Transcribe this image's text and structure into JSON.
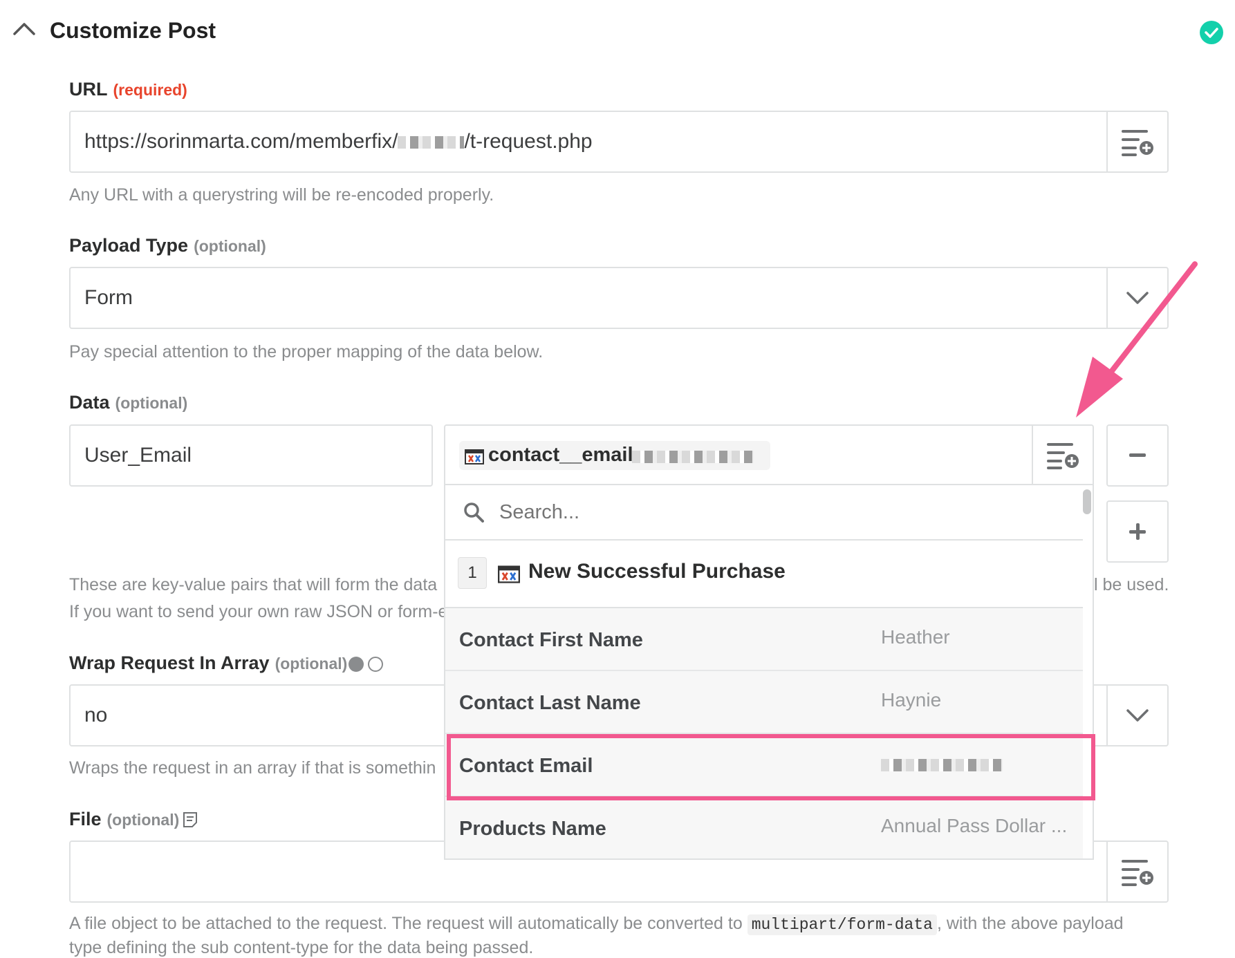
{
  "section": {
    "title": "Customize Post"
  },
  "url_field": {
    "label": "URL",
    "required_tag": "(required)",
    "value_prefix": "https://sorinmarta.com/memberfix/",
    "value_suffix": "/t-request.php",
    "help": "Any URL with a querystring will be re-encoded properly."
  },
  "payload_field": {
    "label": "Payload Type",
    "optional_tag": "(optional)",
    "value": "Form",
    "help": "Pay special attention to the proper mapping of the data below."
  },
  "data_field": {
    "label": "Data",
    "optional_tag": "(optional)",
    "key_value": "User_Email",
    "token_label": "contact__email:",
    "help_line1": "These are key-value pairs that will form the data",
    "help_line1_end": "l be used.",
    "help_line2": "If you want to send your own raw JSON or form-e"
  },
  "dropdown": {
    "search_placeholder": "Search...",
    "step_number": "1",
    "step_title": "New Successful Purchase",
    "items": [
      {
        "key": "Contact First Name",
        "value": "Heather"
      },
      {
        "key": "Contact Last Name",
        "value": "Haynie"
      },
      {
        "key": "Contact Email",
        "value": ""
      },
      {
        "key": "Products Name",
        "value": "Annual Pass Dollar ..."
      }
    ]
  },
  "wrap_field": {
    "label": "Wrap Request In Array",
    "optional_tag": "(optional)",
    "value": "no",
    "help": "Wraps the request in an array if that is somethin"
  },
  "file_field": {
    "label": "File",
    "optional_tag": "(optional)",
    "help_prefix": "A file object to be attached to the request. The request will automatically be converted to",
    "help_code": "multipart/form-data",
    "help_suffix": ", with the above payload",
    "help_line2": "type defining the sub content-type for the data being passed."
  },
  "colors": {
    "accent_check": "#13d0ab",
    "required": "#e8442c",
    "highlight": "#f2598f"
  }
}
